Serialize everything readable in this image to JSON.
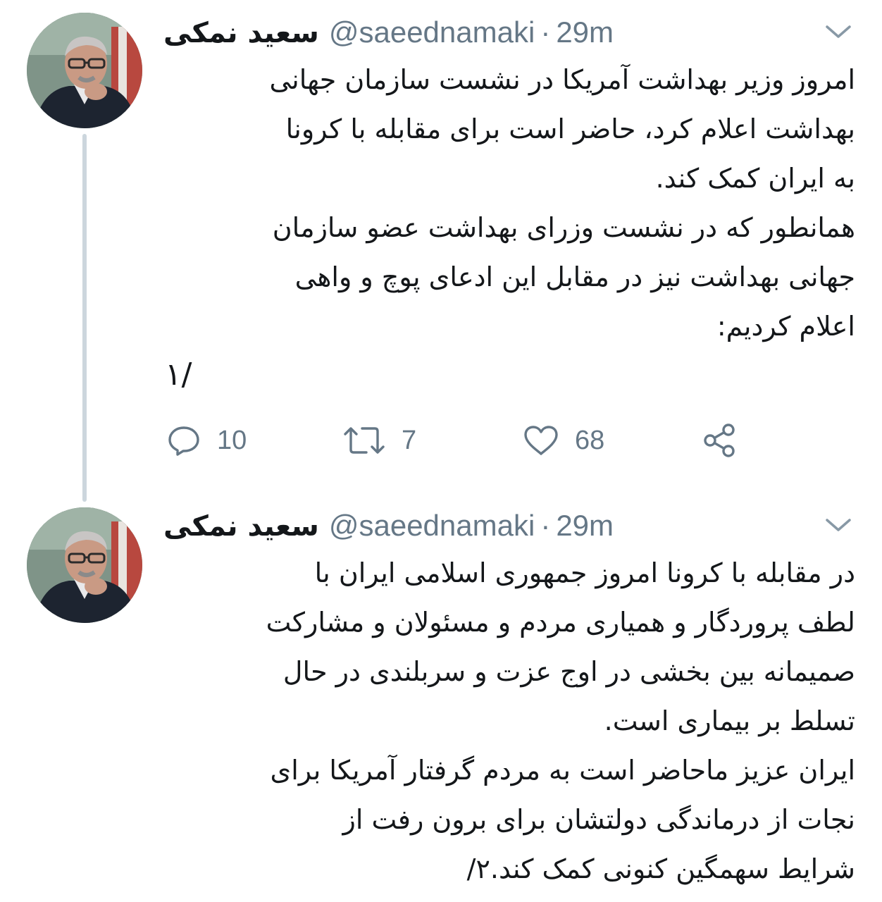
{
  "colors": {
    "text": "#14171a",
    "secondary": "#657786",
    "thread_line": "#ccd6dd",
    "background": "#ffffff"
  },
  "tweets": [
    {
      "display_name": "سعید نمکی",
      "handle": "@saeednamaki",
      "separator": "·",
      "time": "29m",
      "menu_icon": "chevron-down-icon",
      "text_lines": [
        "امروز وزیر بهداشت آمریکا در نشست سازمان جهانی",
        "بهداشت اعلام کرد، حاضر است برای مقابله با کرونا",
        "به ایران کمک کند.",
        "همانطور که در نشست وزرای بهداشت عضو سازمان",
        "جهانی بهداشت نیز در مقابل این ادعای پوچ و واهی",
        "اعلام کردیم:"
      ],
      "thread_number": "۱/",
      "actions": {
        "replies": "10",
        "retweets": "7",
        "likes": "68"
      }
    },
    {
      "display_name": "سعید نمکی",
      "handle": "@saeednamaki",
      "separator": "·",
      "time": "29m",
      "menu_icon": "chevron-down-icon",
      "text_lines": [
        "در مقابله با کرونا امروز جمهوری اسلامی ایران با",
        "لطف پروردگار و همیاری مردم و مسئولان و مشارکت",
        "صمیمانه بین بخشی در اوج عزت و سربلندی در حال",
        "تسلط بر بیماری است.",
        "ایران عزیز ماحاضر است به مردم گرفتار آمریکا برای",
        "نجات از درماندگی دولتشان برای برون رفت از",
        "شرایط سهمگین کنونی کمک کند.۲/"
      ]
    }
  ]
}
